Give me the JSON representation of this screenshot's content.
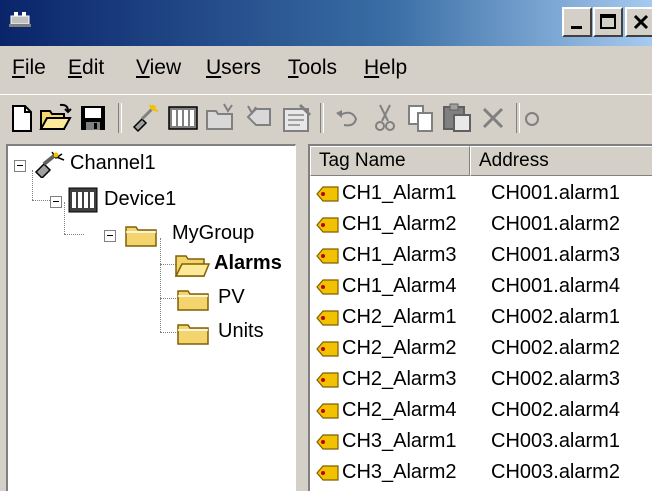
{
  "menu": [
    {
      "label": "File",
      "u": "F",
      "rest": "ile"
    },
    {
      "label": "Edit",
      "u": "E",
      "rest": "dit"
    },
    {
      "label": "View",
      "u": "V",
      "rest": "iew"
    },
    {
      "label": "Users",
      "u": "U",
      "rest": "sers"
    },
    {
      "label": "Tools",
      "u": "T",
      "rest": "ools"
    },
    {
      "label": "Help",
      "u": "H",
      "rest": "elp"
    }
  ],
  "tree": {
    "channel": "Channel1",
    "device": "Device1",
    "group": "MyGroup",
    "children": [
      "Alarms",
      "PV",
      "Units"
    ],
    "selected": "Alarms"
  },
  "list": {
    "columns": [
      "Tag Name",
      "Address"
    ],
    "rows": [
      {
        "name": "CH1_Alarm1",
        "address": "CH001.alarm1"
      },
      {
        "name": "CH1_Alarm2",
        "address": "CH001.alarm2"
      },
      {
        "name": "CH1_Alarm3",
        "address": "CH001.alarm3"
      },
      {
        "name": "CH1_Alarm4",
        "address": "CH001.alarm4"
      },
      {
        "name": "CH2_Alarm1",
        "address": "CH002.alarm1"
      },
      {
        "name": "CH2_Alarm2",
        "address": "CH002.alarm2"
      },
      {
        "name": "CH2_Alarm3",
        "address": "CH002.alarm3"
      },
      {
        "name": "CH2_Alarm4",
        "address": "CH002.alarm4"
      },
      {
        "name": "CH3_Alarm1",
        "address": "CH003.alarm1"
      },
      {
        "name": "CH3_Alarm2",
        "address": "CH003.alarm2"
      }
    ]
  },
  "colors": {
    "titlebar_start": "#0a246a",
    "titlebar_end": "#a6caf0",
    "face": "#d4d0c8",
    "folder": "#f4d46c",
    "tag": "#f2c200"
  },
  "icons": {
    "app": "app-icon",
    "minimize": "minimize-icon",
    "maximize": "maximize-icon",
    "close": "close-icon"
  }
}
